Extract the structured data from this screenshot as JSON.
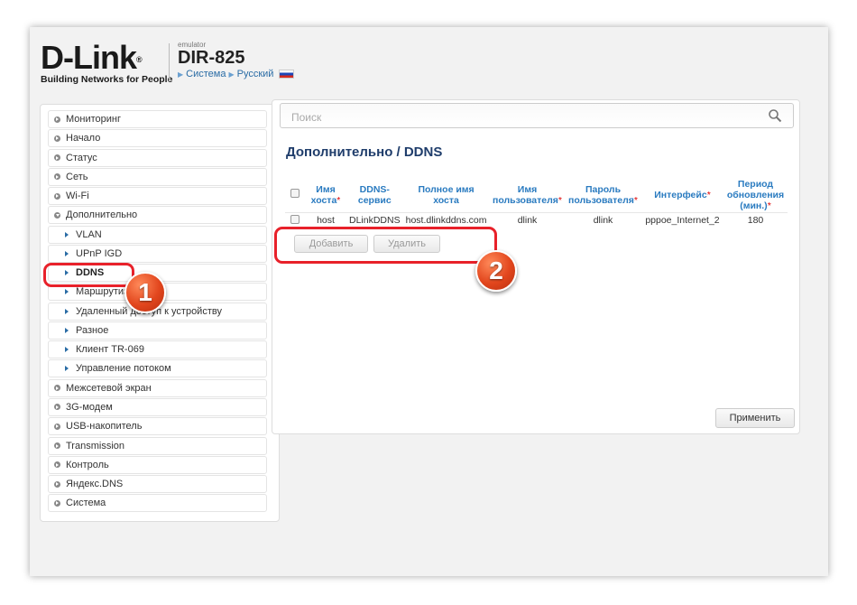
{
  "header": {
    "logo_text": "D-Link",
    "logo_reg": "®",
    "tagline": "Building Networks for People",
    "emulator_label": "emulator",
    "model": "DIR-825",
    "crumb_system": "Система",
    "crumb_language": "Русский"
  },
  "sidebar": {
    "items": [
      {
        "label": "Мониторинг",
        "level": 0
      },
      {
        "label": "Начало",
        "level": 0
      },
      {
        "label": "Статус",
        "level": 0
      },
      {
        "label": "Сеть",
        "level": 0
      },
      {
        "label": "Wi-Fi",
        "level": 0
      },
      {
        "label": "Дополнительно",
        "level": 0,
        "expanded": true
      },
      {
        "label": "VLAN",
        "level": 1
      },
      {
        "label": "UPnP IGD",
        "level": 1
      },
      {
        "label": "DDNS",
        "level": 1,
        "active": true
      },
      {
        "label": "Маршрутизация",
        "level": 1
      },
      {
        "label": "Удаленный доступ к устройству",
        "level": 1
      },
      {
        "label": "Разное",
        "level": 1
      },
      {
        "label": "Клиент TR-069",
        "level": 1
      },
      {
        "label": "Управление потоком",
        "level": 1
      },
      {
        "label": "Межсетевой экран",
        "level": 0
      },
      {
        "label": "3G-модем",
        "level": 0
      },
      {
        "label": "USB-накопитель",
        "level": 0
      },
      {
        "label": "Transmission",
        "level": 0
      },
      {
        "label": "Контроль",
        "level": 0
      },
      {
        "label": "Яндекс.DNS",
        "level": 0
      },
      {
        "label": "Система",
        "level": 0
      }
    ]
  },
  "search": {
    "placeholder": "Поиск"
  },
  "page": {
    "title": "Дополнительно /  DDNS"
  },
  "table": {
    "headers": [
      {
        "lines": [
          "Имя",
          "хоста"
        ],
        "required": true
      },
      {
        "lines": [
          "DDNS-",
          "сервис"
        ],
        "required": false
      },
      {
        "lines": [
          "Полное имя",
          "хоста"
        ],
        "required": false
      },
      {
        "lines": [
          "Имя",
          "пользователя"
        ],
        "required": true
      },
      {
        "lines": [
          "Пароль",
          "пользователя"
        ],
        "required": true
      },
      {
        "lines": [
          "Интерфейс"
        ],
        "required": true
      },
      {
        "lines": [
          "Период",
          "обновления",
          "(мин.)"
        ],
        "required": true
      }
    ],
    "required_mark": "*",
    "rows": [
      [
        "host",
        "DLinkDDNS",
        "host.dlinkddns.com",
        "dlink",
        "dlink",
        "pppoe_Internet_2",
        "180"
      ]
    ]
  },
  "buttons": {
    "add": "Добавить",
    "delete": "Удалить",
    "apply": "Применить"
  },
  "annotations": {
    "badge1": "1",
    "badge2": "2"
  },
  "colors": {
    "accent": "#2a7bc0",
    "highlight": "#e8212a",
    "badge": "#e2461d"
  }
}
